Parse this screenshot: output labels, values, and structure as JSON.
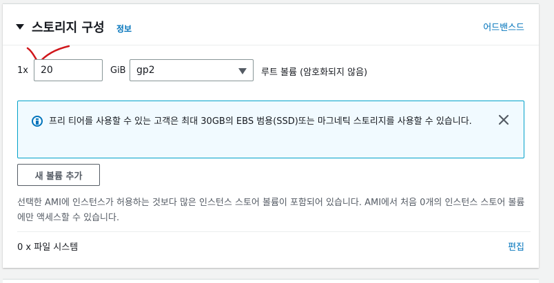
{
  "section": {
    "title": "스토리지 구성",
    "info_link": "정보",
    "advanced_link": "어드밴스드"
  },
  "volume_row": {
    "multiplier": "1x",
    "size_value": "20",
    "unit": "GiB",
    "volume_type": "gp2",
    "root_label": "루트 볼륨  (암호화되지 않음)"
  },
  "info_box": {
    "text": "프리 티어를 사용할 수 있는 고객은 최대 30GB의 EBS 범용(SSD)또는 마그네틱 스토리지를 사용할 수 있습니다."
  },
  "add_volume_button": "새 볼륨 추가",
  "description": "선택한 AMI에 인스턴스가 허용하는 것보다 많은 인스턴스 스토어 볼륨이 포함되어 있습니다. AMI에서 처음 0개의 인스턴스 스토어 볼륨에만 액세스할 수 있습니다.",
  "file_systems": {
    "label": "0 x 파일 시스템",
    "edit_link": "편집"
  },
  "colors": {
    "link": "#0073bb",
    "info_border": "#00a1c9",
    "info_bg": "#f1faff",
    "annotation": "#d0161b"
  },
  "icons": {
    "expand": "caret-down-icon",
    "info": "info-circle-icon",
    "close": "close-icon",
    "dropdown": "chevron-down-icon"
  }
}
